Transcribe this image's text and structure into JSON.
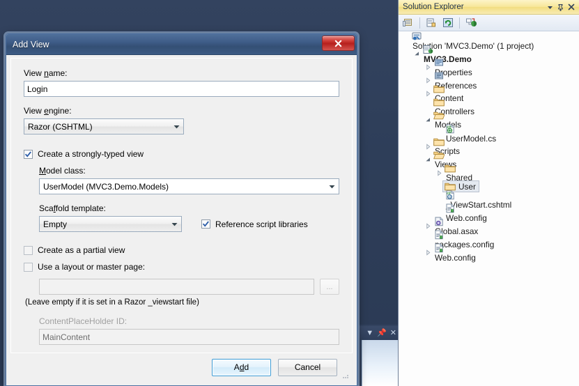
{
  "dialog": {
    "title": "Add View",
    "close_glyph": "✕",
    "view_name": {
      "label_pre": "View ",
      "label_key": "n",
      "label_post": "ame:",
      "value": "Login"
    },
    "view_engine": {
      "label_pre": "View ",
      "label_key": "e",
      "label_post": "ngine:",
      "value": "Razor (CSHTML)"
    },
    "strongly_typed": {
      "label_pre": "Create a ",
      "label_key": "s",
      "label_post": "trongly-typed view",
      "checked": true
    },
    "model_class": {
      "label_pre": "",
      "label_key": "M",
      "label_post": "odel class:",
      "value": "UserModel (MVC3.Demo.Models)"
    },
    "scaffold_template": {
      "label_pre": "Sca",
      "label_key": "f",
      "label_post": "fold template:",
      "value": "Empty"
    },
    "reference_scripts": {
      "label_pre": "",
      "label_key": "R",
      "label_post": "eference script libraries",
      "checked": true
    },
    "partial_view": {
      "label_pre": "",
      "label_key": "C",
      "label_post": "reate as a partial view",
      "checked": false
    },
    "use_layout": {
      "label_pre": "",
      "label_key": "U",
      "label_post": "se a layout or master page:",
      "checked": false
    },
    "layout_path": {
      "value": "",
      "placeholder": ""
    },
    "browse_button": "...",
    "layout_hint": "(Leave empty if it is set in a Razor _viewstart file)",
    "content_placeholder": {
      "label_pre": "ContentPlace",
      "label_key": "H",
      "label_post": "older ID:",
      "value": "MainContent"
    },
    "buttons": {
      "add_pre": "A",
      "add_key": "d",
      "add_post": "d",
      "cancel": "Cancel"
    }
  },
  "solution_explorer": {
    "title": "Solution Explorer",
    "title_buttons": [
      "dropdown",
      "pin",
      "close"
    ],
    "toolbar": [
      "properties-icon",
      "show-all-files-icon",
      "refresh-icon",
      "view-class-diagram-icon"
    ],
    "tree": [
      {
        "label": "Solution 'MVC3.Demo' (1 project)",
        "indent": 0,
        "arrow": "none",
        "icon": "solution",
        "bold": false,
        "selected": false
      },
      {
        "label": "MVC3.Demo",
        "indent": 1,
        "arrow": "expanded",
        "icon": "project",
        "bold": true,
        "selected": false
      },
      {
        "label": "Properties",
        "indent": 2,
        "arrow": "collapsed",
        "icon": "properties",
        "bold": false,
        "selected": false
      },
      {
        "label": "References",
        "indent": 2,
        "arrow": "collapsed",
        "icon": "references",
        "bold": false,
        "selected": false
      },
      {
        "label": "Content",
        "indent": 2,
        "arrow": "collapsed",
        "icon": "folder",
        "bold": false,
        "selected": false
      },
      {
        "label": "Controllers",
        "indent": 2,
        "arrow": "none",
        "icon": "folder",
        "bold": false,
        "selected": false
      },
      {
        "label": "Models",
        "indent": 2,
        "arrow": "expanded",
        "icon": "folder-open",
        "bold": false,
        "selected": false
      },
      {
        "label": "UserModel.cs",
        "indent": 3,
        "arrow": "none",
        "icon": "csharp",
        "bold": false,
        "selected": false
      },
      {
        "label": "Scripts",
        "indent": 2,
        "arrow": "collapsed",
        "icon": "folder",
        "bold": false,
        "selected": false
      },
      {
        "label": "Views",
        "indent": 2,
        "arrow": "expanded",
        "icon": "folder-open",
        "bold": false,
        "selected": false
      },
      {
        "label": "Shared",
        "indent": 3,
        "arrow": "collapsed",
        "icon": "folder",
        "bold": false,
        "selected": false
      },
      {
        "label": "User",
        "indent": 3,
        "arrow": "none",
        "icon": "folder",
        "bold": false,
        "selected": true
      },
      {
        "label": "_ViewStart.cshtml",
        "indent": 3,
        "arrow": "none",
        "icon": "cshtml",
        "bold": false,
        "selected": false
      },
      {
        "label": "Web.config",
        "indent": 3,
        "arrow": "none",
        "icon": "config",
        "bold": false,
        "selected": false
      },
      {
        "label": "Global.asax",
        "indent": 2,
        "arrow": "collapsed",
        "icon": "asax",
        "bold": false,
        "selected": false
      },
      {
        "label": "packages.config",
        "indent": 2,
        "arrow": "none",
        "icon": "config",
        "bold": false,
        "selected": false
      },
      {
        "label": "Web.config",
        "indent": 2,
        "arrow": "collapsed",
        "icon": "config",
        "bold": false,
        "selected": false
      }
    ]
  },
  "background_panel": {
    "title_buttons": [
      "dropdown",
      "pin",
      "close"
    ]
  },
  "colors": {
    "ide_background": "#2f415e",
    "dialog_titlebar": "#3e5c87",
    "close_button": "#b61f1c",
    "panel_title": "#f2dd80",
    "default_button_border": "#3c9cd6",
    "folder": "#f5cf7a"
  }
}
